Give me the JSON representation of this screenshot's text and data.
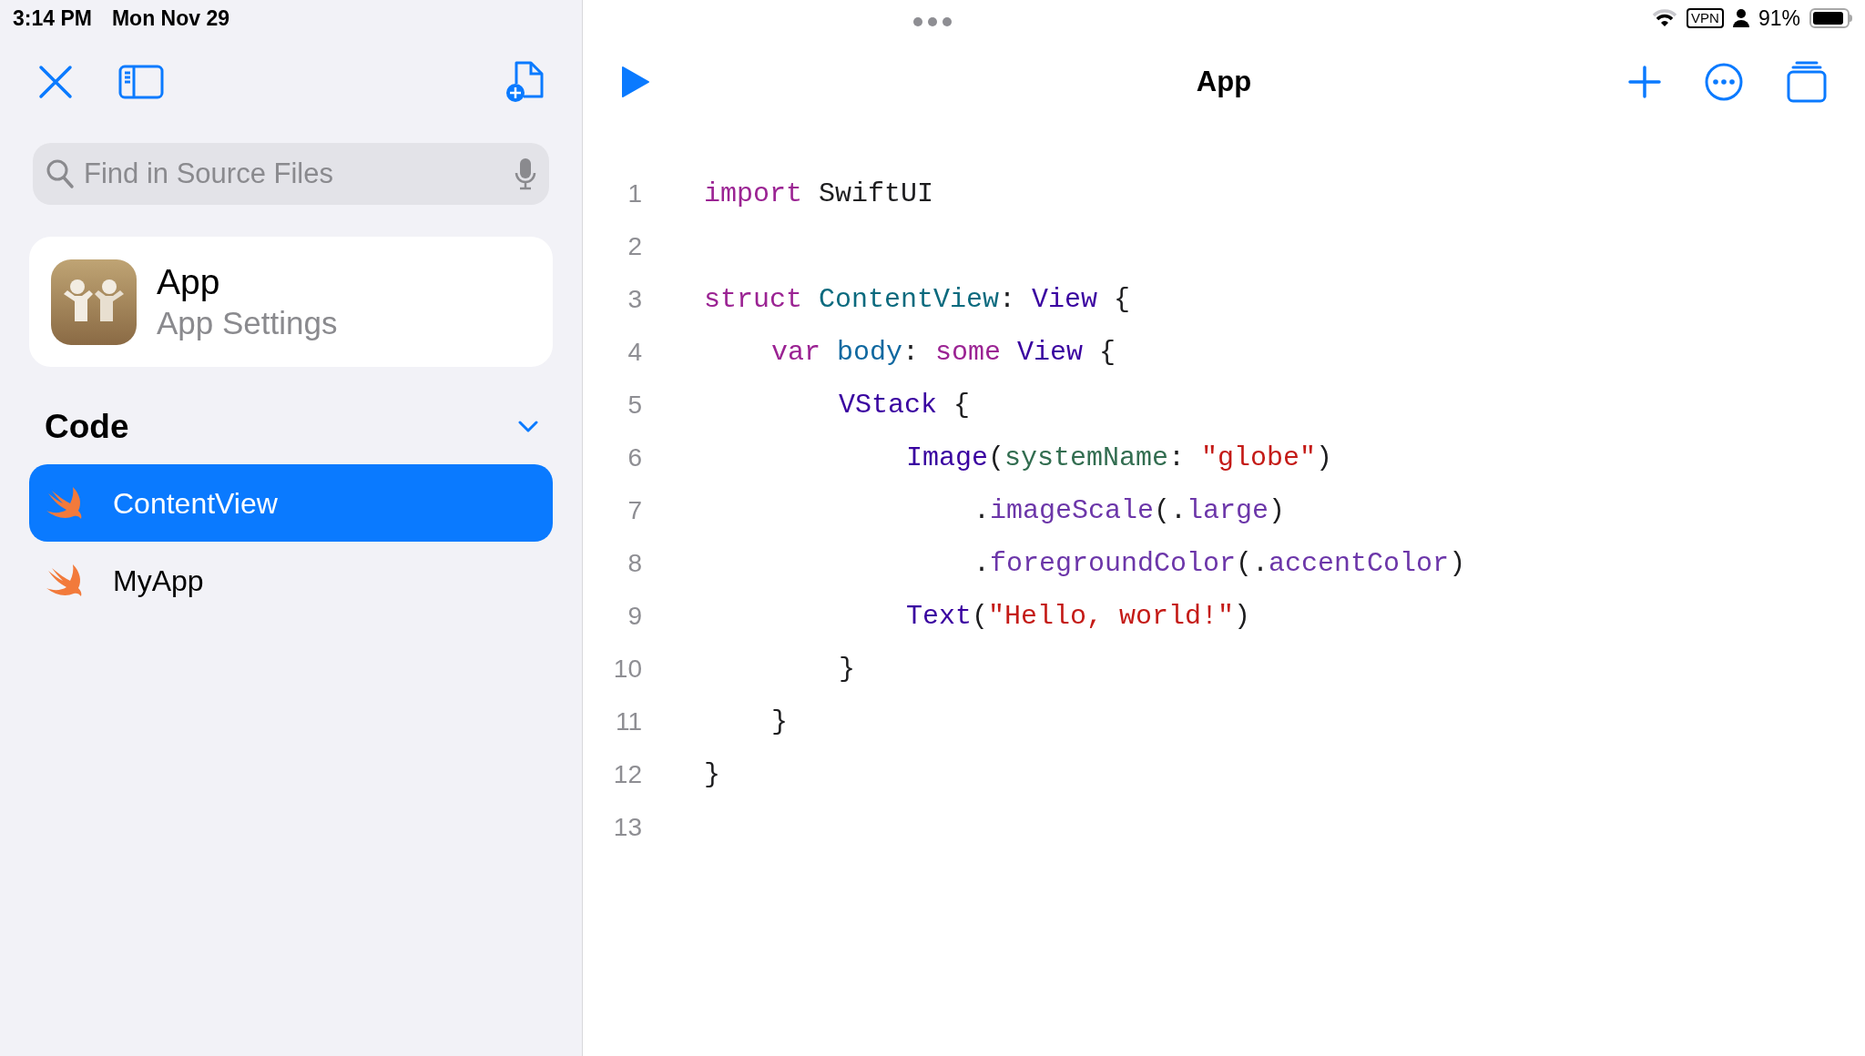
{
  "status_bar": {
    "time": "3:14 PM",
    "date": "Mon Nov 29",
    "vpn": "VPN",
    "battery_text": "91%",
    "level": 0.91
  },
  "sidebar": {
    "search": {
      "placeholder": "Find in Source Files"
    },
    "app_card": {
      "title": "App",
      "subtitle": "App Settings"
    },
    "section": {
      "title": "Code",
      "expanded": true
    },
    "files": [
      {
        "label": "ContentView",
        "selected": true
      },
      {
        "label": "MyApp",
        "selected": false
      }
    ]
  },
  "editor": {
    "title": "App",
    "lines": [
      {
        "number": "1",
        "tokens": [
          {
            "kind": "keyword",
            "text": "import "
          },
          {
            "kind": "plain",
            "text": "SwiftUI"
          }
        ]
      },
      {
        "number": "2"
      },
      {
        "number": "3",
        "tokens": [
          {
            "kind": "keyword",
            "text": "struct "
          },
          {
            "kind": "typedecl",
            "text": "ContentView"
          },
          {
            "kind": "plain",
            "text": ": "
          },
          {
            "kind": "type",
            "text": "View"
          },
          {
            "kind": "plain",
            "text": " {"
          }
        ],
        "children": [
          {
            "number": "4",
            "tokens": [
              {
                "kind": "keyword",
                "text": "var "
              },
              {
                "kind": "decl",
                "text": "body"
              },
              {
                "kind": "plain",
                "text": ": "
              },
              {
                "kind": "keyword",
                "text": "some "
              },
              {
                "kind": "type",
                "text": "View"
              },
              {
                "kind": "plain",
                "text": " {"
              }
            ],
            "children": [
              {
                "number": "5",
                "tokens": [
                  {
                    "kind": "type",
                    "text": "VStack"
                  },
                  {
                    "kind": "plain",
                    "text": " {"
                  }
                ],
                "children": [
                  {
                    "number": "6",
                    "tokens": [
                      {
                        "kind": "type",
                        "text": "Image"
                      },
                      {
                        "kind": "plain",
                        "text": "("
                      },
                      {
                        "kind": "param",
                        "text": "systemName"
                      },
                      {
                        "kind": "plain",
                        "text": ": "
                      },
                      {
                        "kind": "string",
                        "text": "\"globe\""
                      },
                      {
                        "kind": "plain",
                        "text": ")"
                      }
                    ],
                    "children": [
                      {
                        "number": "7",
                        "tokens": [
                          {
                            "kind": "plain",
                            "text": "."
                          },
                          {
                            "kind": "member",
                            "text": "imageScale"
                          },
                          {
                            "kind": "plain",
                            "text": "(."
                          },
                          {
                            "kind": "member",
                            "text": "large"
                          },
                          {
                            "kind": "plain",
                            "text": ")"
                          }
                        ]
                      },
                      {
                        "number": "8",
                        "tokens": [
                          {
                            "kind": "plain",
                            "text": "."
                          },
                          {
                            "kind": "member",
                            "text": "foregroundColor"
                          },
                          {
                            "kind": "plain",
                            "text": "(."
                          },
                          {
                            "kind": "member",
                            "text": "accentColor"
                          },
                          {
                            "kind": "plain",
                            "text": ")"
                          }
                        ]
                      }
                    ]
                  },
                  {
                    "number": "9",
                    "tokens": [
                      {
                        "kind": "type",
                        "text": "Text"
                      },
                      {
                        "kind": "plain",
                        "text": "("
                      },
                      {
                        "kind": "string",
                        "text": "\"Hello, world!\""
                      },
                      {
                        "kind": "plain",
                        "text": ")"
                      }
                    ]
                  }
                ]
              },
              {
                "number": "10",
                "tokens": [
                  {
                    "kind": "plain",
                    "text": "}"
                  }
                ]
              }
            ]
          },
          {
            "number": "11",
            "tokens": [
              {
                "kind": "plain",
                "text": "}"
              }
            ]
          }
        ]
      },
      {
        "number": "12",
        "tokens": [
          {
            "kind": "plain",
            "text": "}"
          }
        ]
      },
      {
        "number": "13"
      }
    ]
  }
}
